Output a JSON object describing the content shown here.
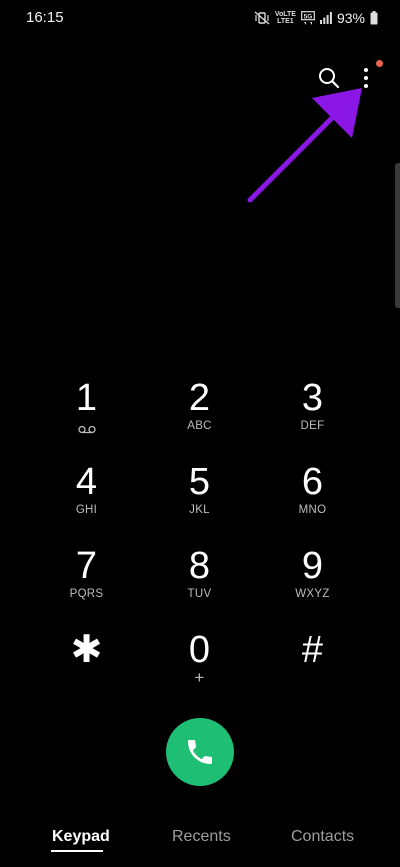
{
  "status_bar": {
    "time": "16:15",
    "network_label_top": "VoLTE",
    "network_label_bottom": "LTE1",
    "network_type": "5G",
    "battery": "93%",
    "icons": [
      "mute-vibrate-icon",
      "volte-icon",
      "5g-icon",
      "signal-icon",
      "battery-icon"
    ]
  },
  "top_actions": {
    "search_icon": "search-icon",
    "more_icon": "more-vertical-icon"
  },
  "colors": {
    "background": "#000000",
    "call_button": "#1fbe75",
    "notification_dot": "#e8664a",
    "annotation_arrow": "#8b17e6",
    "inactive_tab": "#9e9e9e"
  },
  "keypad": {
    "keys": [
      {
        "digit": "1",
        "sub": "",
        "sub_icon": "voicemail-icon"
      },
      {
        "digit": "2",
        "sub": "ABC"
      },
      {
        "digit": "3",
        "sub": "DEF"
      },
      {
        "digit": "4",
        "sub": "GHI"
      },
      {
        "digit": "5",
        "sub": "JKL"
      },
      {
        "digit": "6",
        "sub": "MNO"
      },
      {
        "digit": "7",
        "sub": "PQRS"
      },
      {
        "digit": "8",
        "sub": "TUV"
      },
      {
        "digit": "9",
        "sub": "WXYZ"
      },
      {
        "digit": "✱",
        "sub": ""
      },
      {
        "digit": "0",
        "sub": "+"
      },
      {
        "digit": "#",
        "sub": ""
      }
    ]
  },
  "call_button_icon": "phone-icon",
  "tabs": [
    {
      "label": "Keypad",
      "active": true
    },
    {
      "label": "Recents",
      "active": false
    },
    {
      "label": "Contacts",
      "active": false
    }
  ]
}
